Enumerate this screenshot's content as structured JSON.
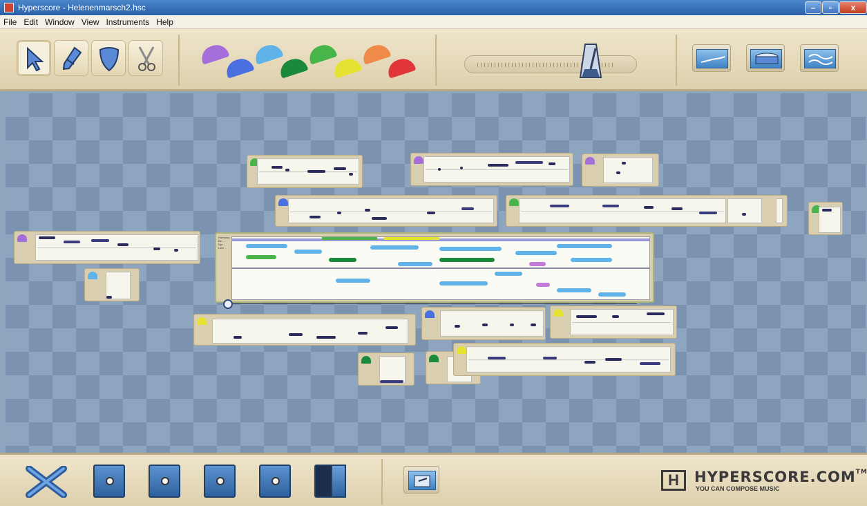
{
  "window": {
    "title": "Hyperscore - Helenenmarsch2.hsc",
    "controls": {
      "minimize": "–",
      "maximize": "▫",
      "close": "x"
    }
  },
  "menu": {
    "items": [
      "File",
      "Edit",
      "Window",
      "View",
      "Instruments",
      "Help"
    ]
  },
  "toolbar": {
    "tools": [
      {
        "name": "select-tool",
        "icon": "arrow-icon"
      },
      {
        "name": "pen-tool",
        "icon": "pen-icon"
      },
      {
        "name": "shield-tool",
        "icon": "shield-icon"
      },
      {
        "name": "scissors-tool",
        "icon": "scissors-icon"
      }
    ],
    "colors": [
      {
        "name": "purple",
        "hex": "#a56fd9"
      },
      {
        "name": "blue",
        "hex": "#4a6fe0"
      },
      {
        "name": "light-blue",
        "hex": "#5fb3e8"
      },
      {
        "name": "dark-green",
        "hex": "#1a8a3a"
      },
      {
        "name": "light-green",
        "hex": "#48b54a"
      },
      {
        "name": "yellow",
        "hex": "#e6e234"
      },
      {
        "name": "orange",
        "hex": "#f08a4a"
      },
      {
        "name": "red",
        "hex": "#e0363a"
      }
    ],
    "tempo": {
      "icon": "metronome-icon"
    },
    "playback": [
      {
        "name": "play-melody-button",
        "icon": "melody-icon"
      },
      {
        "name": "play-drum-button",
        "icon": "drum-icon"
      },
      {
        "name": "play-harmony-button",
        "icon": "waves-icon"
      }
    ]
  },
  "composition": {
    "legend_title": "Harmony",
    "legend_items": [
      "Be ...",
      "Nyr ...",
      "Lam"
    ]
  },
  "bottom": {
    "delete_icon": "x-icon",
    "safes": [
      "safe-1",
      "safe-2",
      "safe-3",
      "safe-4",
      "safe-5-open"
    ],
    "export_icon": "export-icon",
    "logo": {
      "brand": "HYPERSCORE.COM",
      "trademark": "TM",
      "tagline": "YOU CAN COMPOSE MUSIC",
      "mark": "H"
    }
  }
}
